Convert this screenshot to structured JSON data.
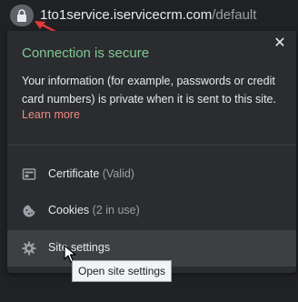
{
  "address_bar": {
    "host": "1to1service.iservicecrm.com",
    "path": "/default",
    "lock_icon": "lock-icon"
  },
  "popup": {
    "title": "Connection is secure",
    "description": "Your information (for example, passwords or credit card numbers) is private when it is sent to this site.",
    "learn_more": "Learn more",
    "close_icon": "close-icon",
    "items": [
      {
        "label": "Certificate",
        "sub": "(Valid)",
        "icon": "certificate-icon"
      },
      {
        "label": "Cookies",
        "sub": "(2 in use)",
        "icon": "cookie-icon"
      },
      {
        "label": "Site settings",
        "sub": "",
        "icon": "gear-icon"
      }
    ]
  },
  "tooltip": "Open site settings",
  "colors": {
    "secure_green": "#81c995",
    "link_red": "#f28b82",
    "annotation_arrow": "#e53935"
  }
}
